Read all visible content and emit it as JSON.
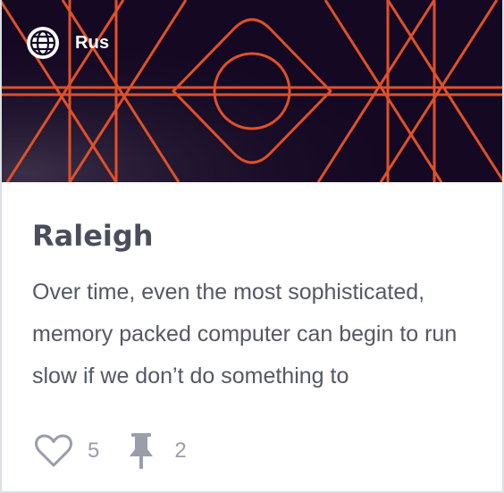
{
  "card": {
    "language": {
      "label": "Rus",
      "icon": "globe-icon"
    },
    "title": "Raleigh",
    "excerpt": "Over time, even the most sophisticated, memory packed computer can begin to run slow if we don’t do something to",
    "stats": {
      "likes": {
        "icon": "heart-icon",
        "count": "5"
      },
      "pins": {
        "icon": "pushpin-icon",
        "count": "2"
      }
    }
  },
  "colors": {
    "banner_background": "#140822",
    "banner_lines": "#e0502a",
    "title_text": "#4a4e5c",
    "body_text": "#545866",
    "muted": "#9a9daa"
  }
}
